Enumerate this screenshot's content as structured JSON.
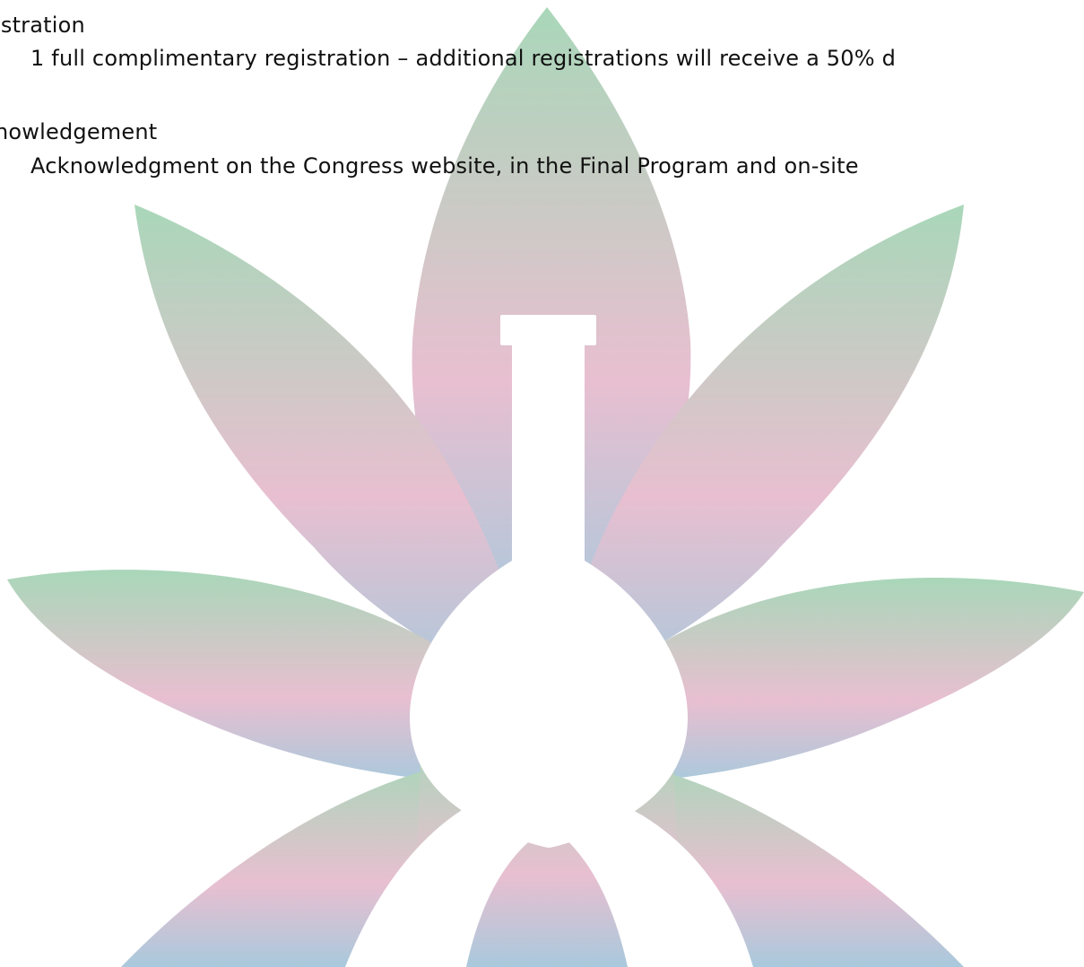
{
  "sections": [
    {
      "heading": "istration",
      "detail": "1 full complimentary registration – additional registrations will receive a 50% d"
    },
    {
      "heading": "nowledgement",
      "detail": "Acknowledgment on the Congress website, in the Final Program and on-site"
    }
  ],
  "emblem": {
    "icon": "cannabis-leaf-flask-icon",
    "colors": {
      "top": "#a9d7b9",
      "middle": "#e8bfd0",
      "bottom": "#a9c9dc",
      "flask": "#ffffff"
    }
  }
}
